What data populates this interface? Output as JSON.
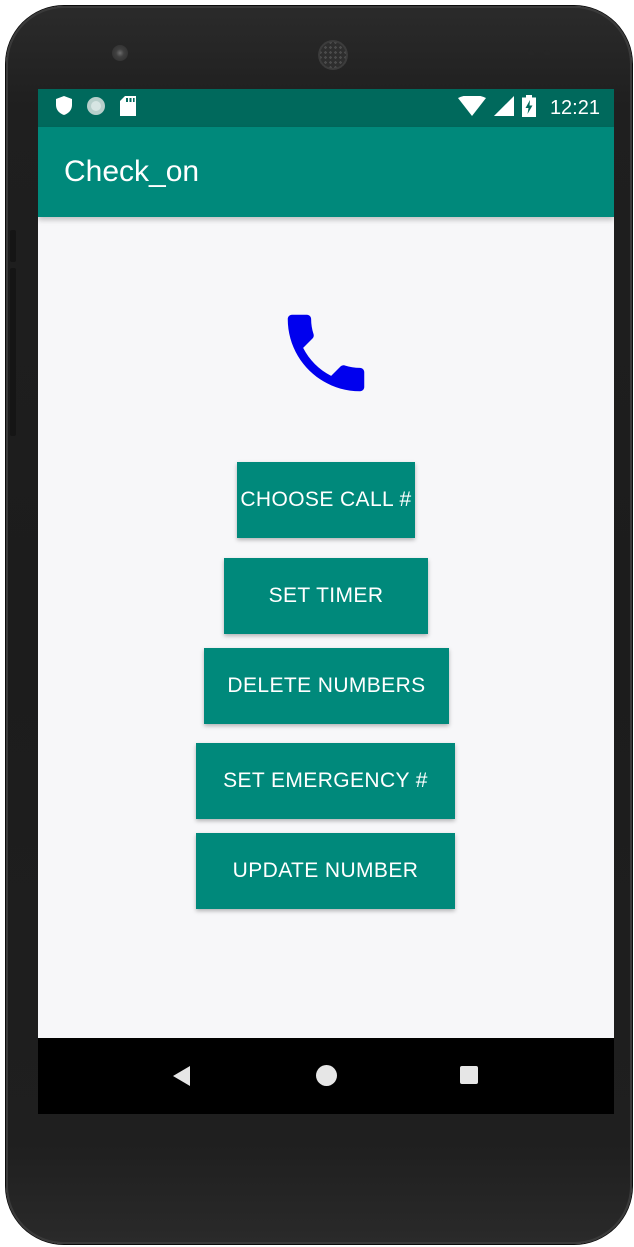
{
  "status_bar": {
    "time": "12:21",
    "left_icons": [
      "shield-icon",
      "circle-notification-icon",
      "sd-card-icon"
    ],
    "right_icons": [
      "wifi-icon",
      "cell-signal-icon",
      "battery-charging-icon"
    ]
  },
  "app_bar": {
    "title": "Check_on"
  },
  "main": {
    "icon": "phone-icon",
    "icon_color": "#0000ee",
    "buttons": [
      {
        "label": "CHOOSE CALL #"
      },
      {
        "label": "SET TIMER"
      },
      {
        "label": "DELETE NUMBERS"
      },
      {
        "label": "SET EMERGENCY #"
      },
      {
        "label": "UPDATE NUMBER"
      }
    ]
  },
  "nav_bar": {
    "icons": [
      "back-icon",
      "home-icon",
      "recents-icon"
    ]
  },
  "colors": {
    "primary": "#00897b",
    "primary_dark": "#00695c",
    "background": "#f7f7f9"
  }
}
